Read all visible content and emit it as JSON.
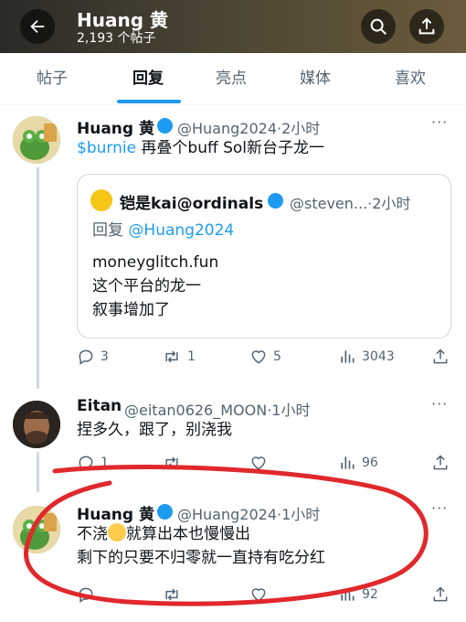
{
  "header": {
    "title": "Huang 黄",
    "post_count": "2,193 个帖子"
  },
  "tabs": [
    "帖子",
    "回复",
    "亮点",
    "媒体",
    "喜欢"
  ],
  "active_tab": "回复",
  "tweets": [
    {
      "name": "Huang 黄",
      "handle": "@Huang2024·2小时",
      "text_link": "$burnie",
      "text": " 再叠个buff Sol新台子龙一",
      "quote": {
        "name": "铠是kai@ordinals",
        "handle": "@steven...·2小时",
        "reply_prefix": "回复 ",
        "reply_to": "@Huang2024",
        "lines": [
          "moneyglitch.fun",
          "这个平台的龙一",
          "叙事增加了"
        ]
      },
      "actions": {
        "replies": "3",
        "reposts": "1",
        "likes": "5",
        "views": "3043"
      }
    },
    {
      "name": "Eitan",
      "handle": "@eitan0626_MOON·1小时",
      "text": "捏多久，跟了，别浇我",
      "actions": {
        "replies": "1",
        "views": "96"
      }
    },
    {
      "name": "Huang 黄",
      "handle": "@Huang2024·1小时",
      "text_a": "不浇",
      "text_b": "就算出本也慢慢出",
      "text2": "剩下的只要不归零就一直持有吃分红",
      "actions": {
        "views": "92"
      }
    }
  ],
  "colors": {
    "accent": "#1d9bf0",
    "annotation": "#e0282d",
    "secondary_text": "#536471"
  }
}
